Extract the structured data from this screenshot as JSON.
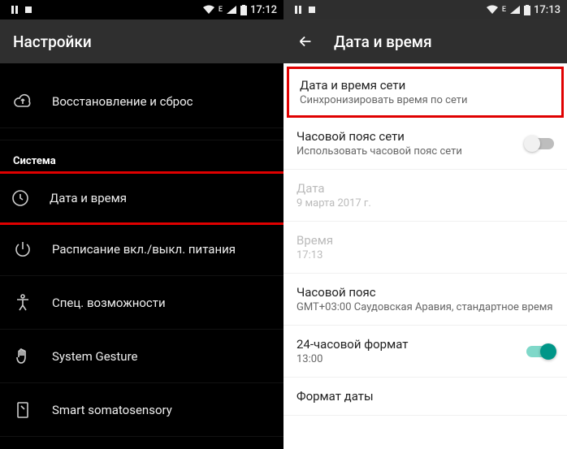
{
  "left": {
    "status": {
      "time": "17:12",
      "network_label": "E"
    },
    "appbar_title": "Настройки",
    "items": {
      "backup": {
        "label": "Восстановление и сброс"
      },
      "section": {
        "label": "Система"
      },
      "datetime": {
        "label": "Дата и время"
      },
      "schedule": {
        "label": "Расписание вкл./выкл. питания"
      },
      "access": {
        "label": "Спец. возможности"
      },
      "gesture": {
        "label": "System Gesture"
      },
      "somato": {
        "label": "Smart somatosensory"
      }
    }
  },
  "right": {
    "status": {
      "time": "17:13",
      "network_label": "E"
    },
    "appbar_title": "Дата и время",
    "rows": {
      "net_time": {
        "title": "Дата и время сети",
        "sub": "Синхронизировать время по сети"
      },
      "net_tz": {
        "title": "Часовой пояс сети",
        "sub": "Использовать часовой пояс сети"
      },
      "date": {
        "title": "Дата",
        "sub": "9 марта 2017 г."
      },
      "time": {
        "title": "Время",
        "sub": "17:13"
      },
      "tz": {
        "title": "Часовой пояс",
        "sub": "GMT+03:00 Саудовская Аравия, стандартное время"
      },
      "fmt24": {
        "title": "24-часовой формат",
        "sub": "13:00"
      },
      "datefmt": {
        "title": "Формат даты"
      }
    }
  }
}
